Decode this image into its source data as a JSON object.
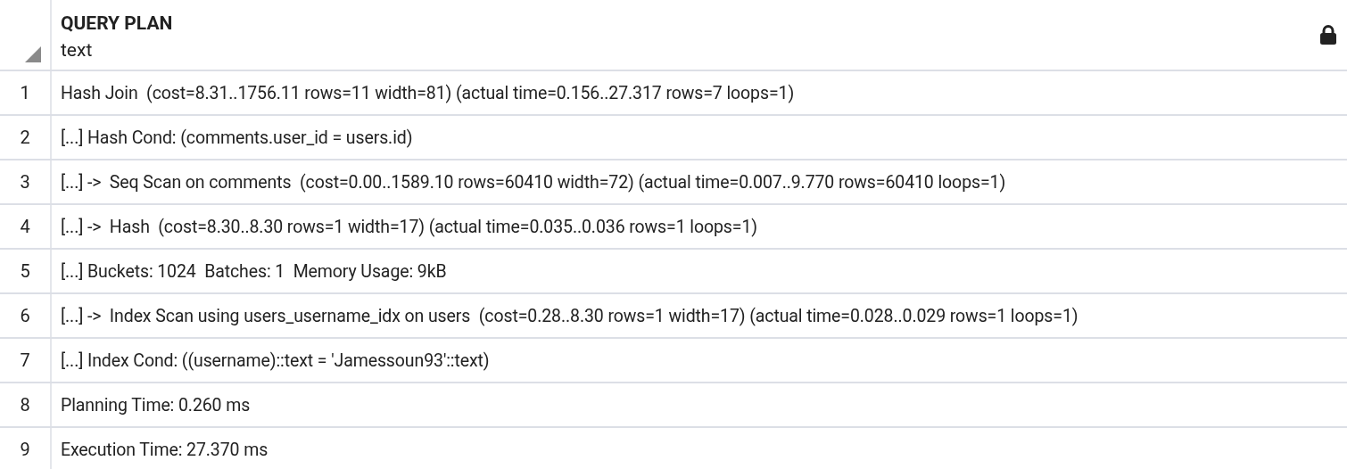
{
  "table": {
    "columns": [
      {
        "name": "QUERY PLAN",
        "type": "text",
        "locked": true
      }
    ],
    "rows": [
      {
        "number": "1",
        "text": "Hash Join  (cost=8.31..1756.11 rows=11 width=81) (actual time=0.156..27.317 rows=7 loops=1)"
      },
      {
        "number": "2",
        "text": "[...] Hash Cond: (comments.user_id = users.id)"
      },
      {
        "number": "3",
        "text": "[...] ->  Seq Scan on comments  (cost=0.00..1589.10 rows=60410 width=72) (actual time=0.007..9.770 rows=60410 loops=1)"
      },
      {
        "number": "4",
        "text": "[...] ->  Hash  (cost=8.30..8.30 rows=1 width=17) (actual time=0.035..0.036 rows=1 loops=1)"
      },
      {
        "number": "5",
        "text": "[...] Buckets: 1024  Batches: 1  Memory Usage: 9kB"
      },
      {
        "number": "6",
        "text": "[...] ->  Index Scan using users_username_idx on users  (cost=0.28..8.30 rows=1 width=17) (actual time=0.028..0.029 rows=1 loops=1)"
      },
      {
        "number": "7",
        "text": "[...] Index Cond: ((username)::text = 'Jamessoun93'::text)"
      },
      {
        "number": "8",
        "text": "Planning Time: 0.260 ms"
      },
      {
        "number": "9",
        "text": "Execution Time: 27.370 ms"
      }
    ]
  }
}
